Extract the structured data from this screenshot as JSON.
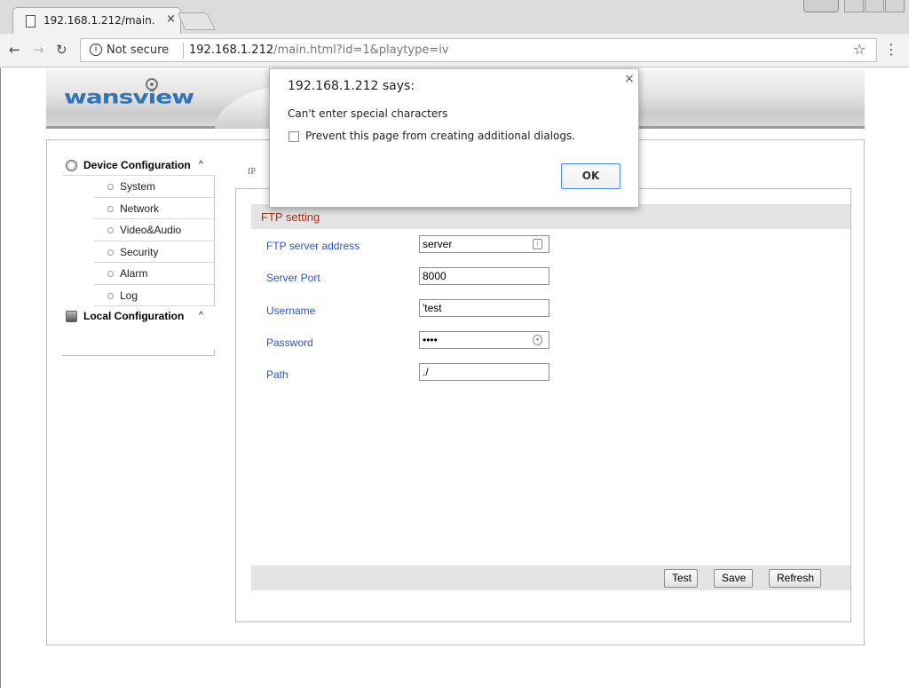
{
  "browser": {
    "tab_title": "192.168.1.212/main.",
    "tab_close": "×",
    "not_secure": "Not secure",
    "url_host": "192.168.1.212",
    "url_path": "/main.html?id=1&playtype=iv"
  },
  "dialog": {
    "title": "192.168.1.212 says:",
    "message": "Can't enter special characters",
    "checkbox_label": "Prevent this page from creating additional dialogs.",
    "ok_label": "OK",
    "close": "×"
  },
  "logo_text": "wansview",
  "sidebar": {
    "groups": [
      {
        "label": "Device Configuration",
        "caret": "^",
        "items": [
          "System",
          "Network",
          "Video&Audio",
          "Security",
          "Alarm",
          "Log"
        ]
      },
      {
        "label": "Local Configuration",
        "caret": "^"
      }
    ]
  },
  "breadcrumb": "IP",
  "section": {
    "title": "FTP setting",
    "fields": [
      {
        "label": "FTP server address",
        "value": "server",
        "type": "text"
      },
      {
        "label": "Server Port",
        "value": "8000",
        "type": "text"
      },
      {
        "label": "Username",
        "value": "'test",
        "type": "text"
      },
      {
        "label": "Password",
        "value": "••••",
        "type": "password"
      },
      {
        "label": "Path",
        "value": "./",
        "type": "text"
      }
    ]
  },
  "buttons": {
    "test": "Test",
    "save": "Save",
    "refresh": "Refresh"
  }
}
